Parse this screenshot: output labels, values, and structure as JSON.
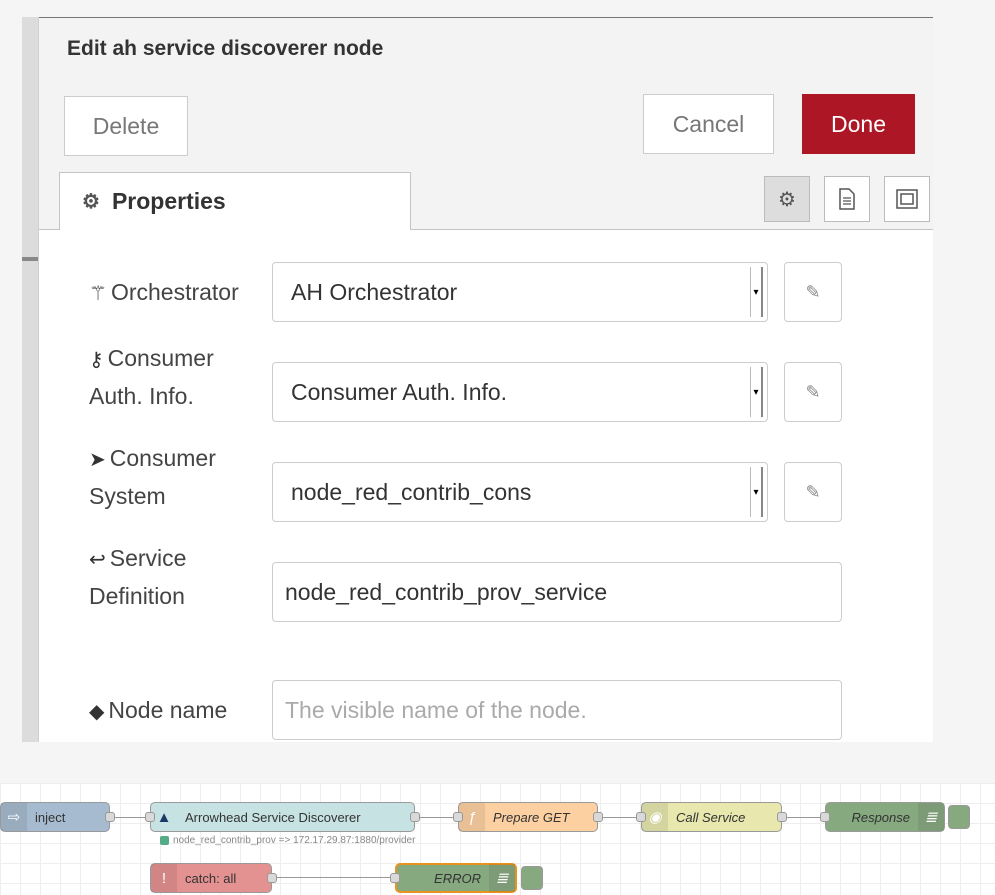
{
  "dialog": {
    "title": "Edit ah service discoverer node",
    "delete_label": "Delete",
    "cancel_label": "Cancel",
    "done_label": "Done",
    "tab_label": "Properties"
  },
  "form": {
    "orchestrator": {
      "label": "Orchestrator",
      "value": "AH Orchestrator",
      "icon": "magic-wand-icon"
    },
    "consumer_auth": {
      "label_line1": "Consumer",
      "label_line2": "Auth. Info.",
      "value": "Consumer Auth. Info.",
      "icon": "key-icon"
    },
    "consumer_system": {
      "label_line1": "Consumer",
      "label_line2": "System",
      "value": "node_red_contrib_cons",
      "icon": "paper-plane-icon"
    },
    "service_definition": {
      "label_line1": "Service",
      "label_line2": "Definition",
      "value": "node_red_contrib_prov_service",
      "icon": "reply-arrow-icon"
    },
    "node_name": {
      "label": "Node name",
      "placeholder": "The visible name of the node.",
      "icon": "tag-icon"
    }
  },
  "flow": {
    "nodes": {
      "inject": "inject",
      "discoverer": "Arrowhead Service Discoverer",
      "discoverer_status": "node_red_contrib_prov => 172.17.29.87:1880/provider",
      "prepare": "Prepare GET",
      "call": "Call Service",
      "response": "Response",
      "catch": "catch: all",
      "error": "ERROR"
    }
  },
  "colors": {
    "done": "#ad1625",
    "inject": "#a6bbcf",
    "discoverer": "#c7e2e2",
    "function": "#fdd0a2",
    "http": "#e7e7ae",
    "debug": "#87a980",
    "catch": "#e49191"
  }
}
